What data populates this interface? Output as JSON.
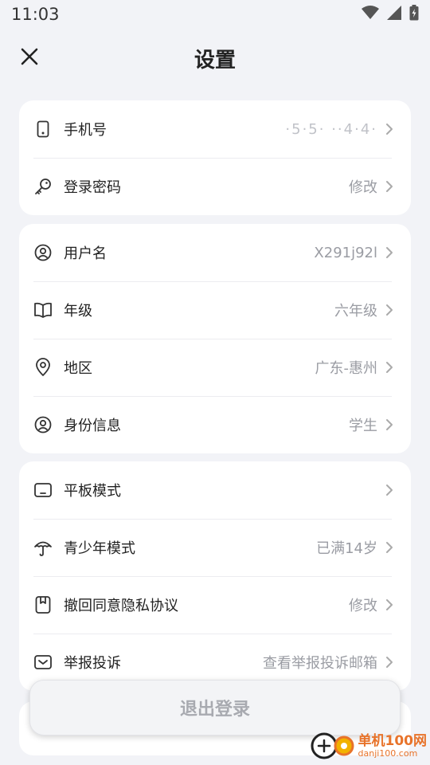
{
  "status_bar": {
    "time": "11:03"
  },
  "header": {
    "title": "设置"
  },
  "account_card": [
    {
      "label": "手机号",
      "value": "·5·5·  ··4·4·",
      "icon": "phone-icon"
    },
    {
      "label": "登录密码",
      "value": "修改",
      "icon": "key-icon"
    }
  ],
  "profile_card": [
    {
      "label": "用户名",
      "value": "X291j92l",
      "icon": "user-icon"
    },
    {
      "label": "年级",
      "value": "六年级",
      "icon": "book-icon"
    },
    {
      "label": "地区",
      "value": "广东-惠州",
      "icon": "location-icon"
    },
    {
      "label": "身份信息",
      "value": "学生",
      "icon": "identity-icon"
    }
  ],
  "settings_card": [
    {
      "label": "平板模式",
      "value": "",
      "icon": "tablet-icon"
    },
    {
      "label": "青少年模式",
      "value": "已满14岁",
      "icon": "umbrella-icon"
    },
    {
      "label": "撤回同意隐私协议",
      "value": "修改",
      "icon": "bookmark-icon"
    },
    {
      "label": "举报投诉",
      "value": "查看举报投诉邮箱",
      "icon": "mail-icon"
    }
  ],
  "logout": {
    "label": "退出登录"
  },
  "watermark": {
    "line1": "单机100网",
    "line2": "danji100.com"
  }
}
